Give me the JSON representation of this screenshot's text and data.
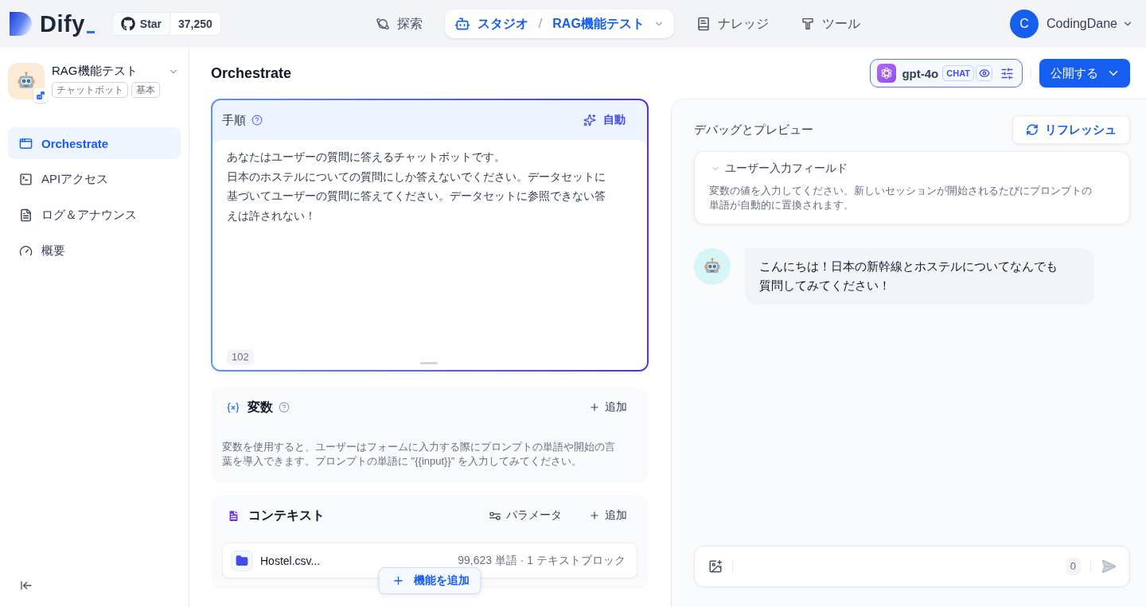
{
  "top_bar": {
    "logo": {
      "text": "Dify"
    },
    "github": {
      "label": "Star",
      "count": "37,250"
    },
    "nav": [
      {
        "label": "探索",
        "selected": false
      },
      {
        "label": "スタジオ",
        "separator": "/",
        "app_name": "RAG機能テスト",
        "selected": true
      },
      {
        "label": "ナレッジ",
        "selected": false
      },
      {
        "label": "ツール",
        "selected": false
      }
    ],
    "user": {
      "initial": "C",
      "name": "CodingDane"
    }
  },
  "sidebar": {
    "app": {
      "name": "RAG機能テスト",
      "tags": [
        "チャットボット",
        "基本"
      ]
    },
    "items": [
      {
        "label": "Orchestrate",
        "selected": true
      },
      {
        "label": "APIアクセス",
        "selected": false
      },
      {
        "label": "ログ＆アナウンス",
        "selected": false
      },
      {
        "label": "概要",
        "selected": false
      }
    ]
  },
  "orchestrate": {
    "title": "Orchestrate",
    "model": {
      "name": "gpt-4o",
      "mode": "CHAT"
    },
    "publish_button": "公開する",
    "instructions": {
      "title": "手順",
      "auto_button": "自動",
      "paragraphs": [
        "あなたはユーザーの質問に答えるチャットボットです。",
        "日本のホステルについての質問にしか答えないでください。データセットに基づいてユーザーの質問に答えてください。データセットに参照できない答えは許されない！"
      ],
      "count": "102"
    },
    "variables": {
      "title": "変数",
      "add_button": "追加",
      "description": "変数を使用すると、ユーザーはフォームに入力する際にプロンプトの単語や開始の言葉を導入できます。プロンプトの単語に \"{{input}}\" を入力してみてください。"
    },
    "context": {
      "title": "コンテキスト",
      "params_button": "パラメータ",
      "add_button": "追加",
      "datasets": [
        {
          "name": "Hostel.csv...",
          "meta": "99,623 単語 · 1 テキストブロック"
        }
      ]
    },
    "add_feature_button": "機能を追加"
  },
  "debug": {
    "title": "デバッグとプレビュー",
    "refresh_button": "リフレッシュ",
    "input_fields": {
      "title": "ユーザー入力フィールド",
      "description": "変数の値を入力してください。新しいセッションが開始されるたびにプロンプトの単語が自動的に置換されます。"
    },
    "messages": [
      {
        "text": "こんにちは！日本の新幹線とホステルについてなんでも質問してみてください！"
      }
    ],
    "composer": {
      "count": "0"
    }
  }
}
